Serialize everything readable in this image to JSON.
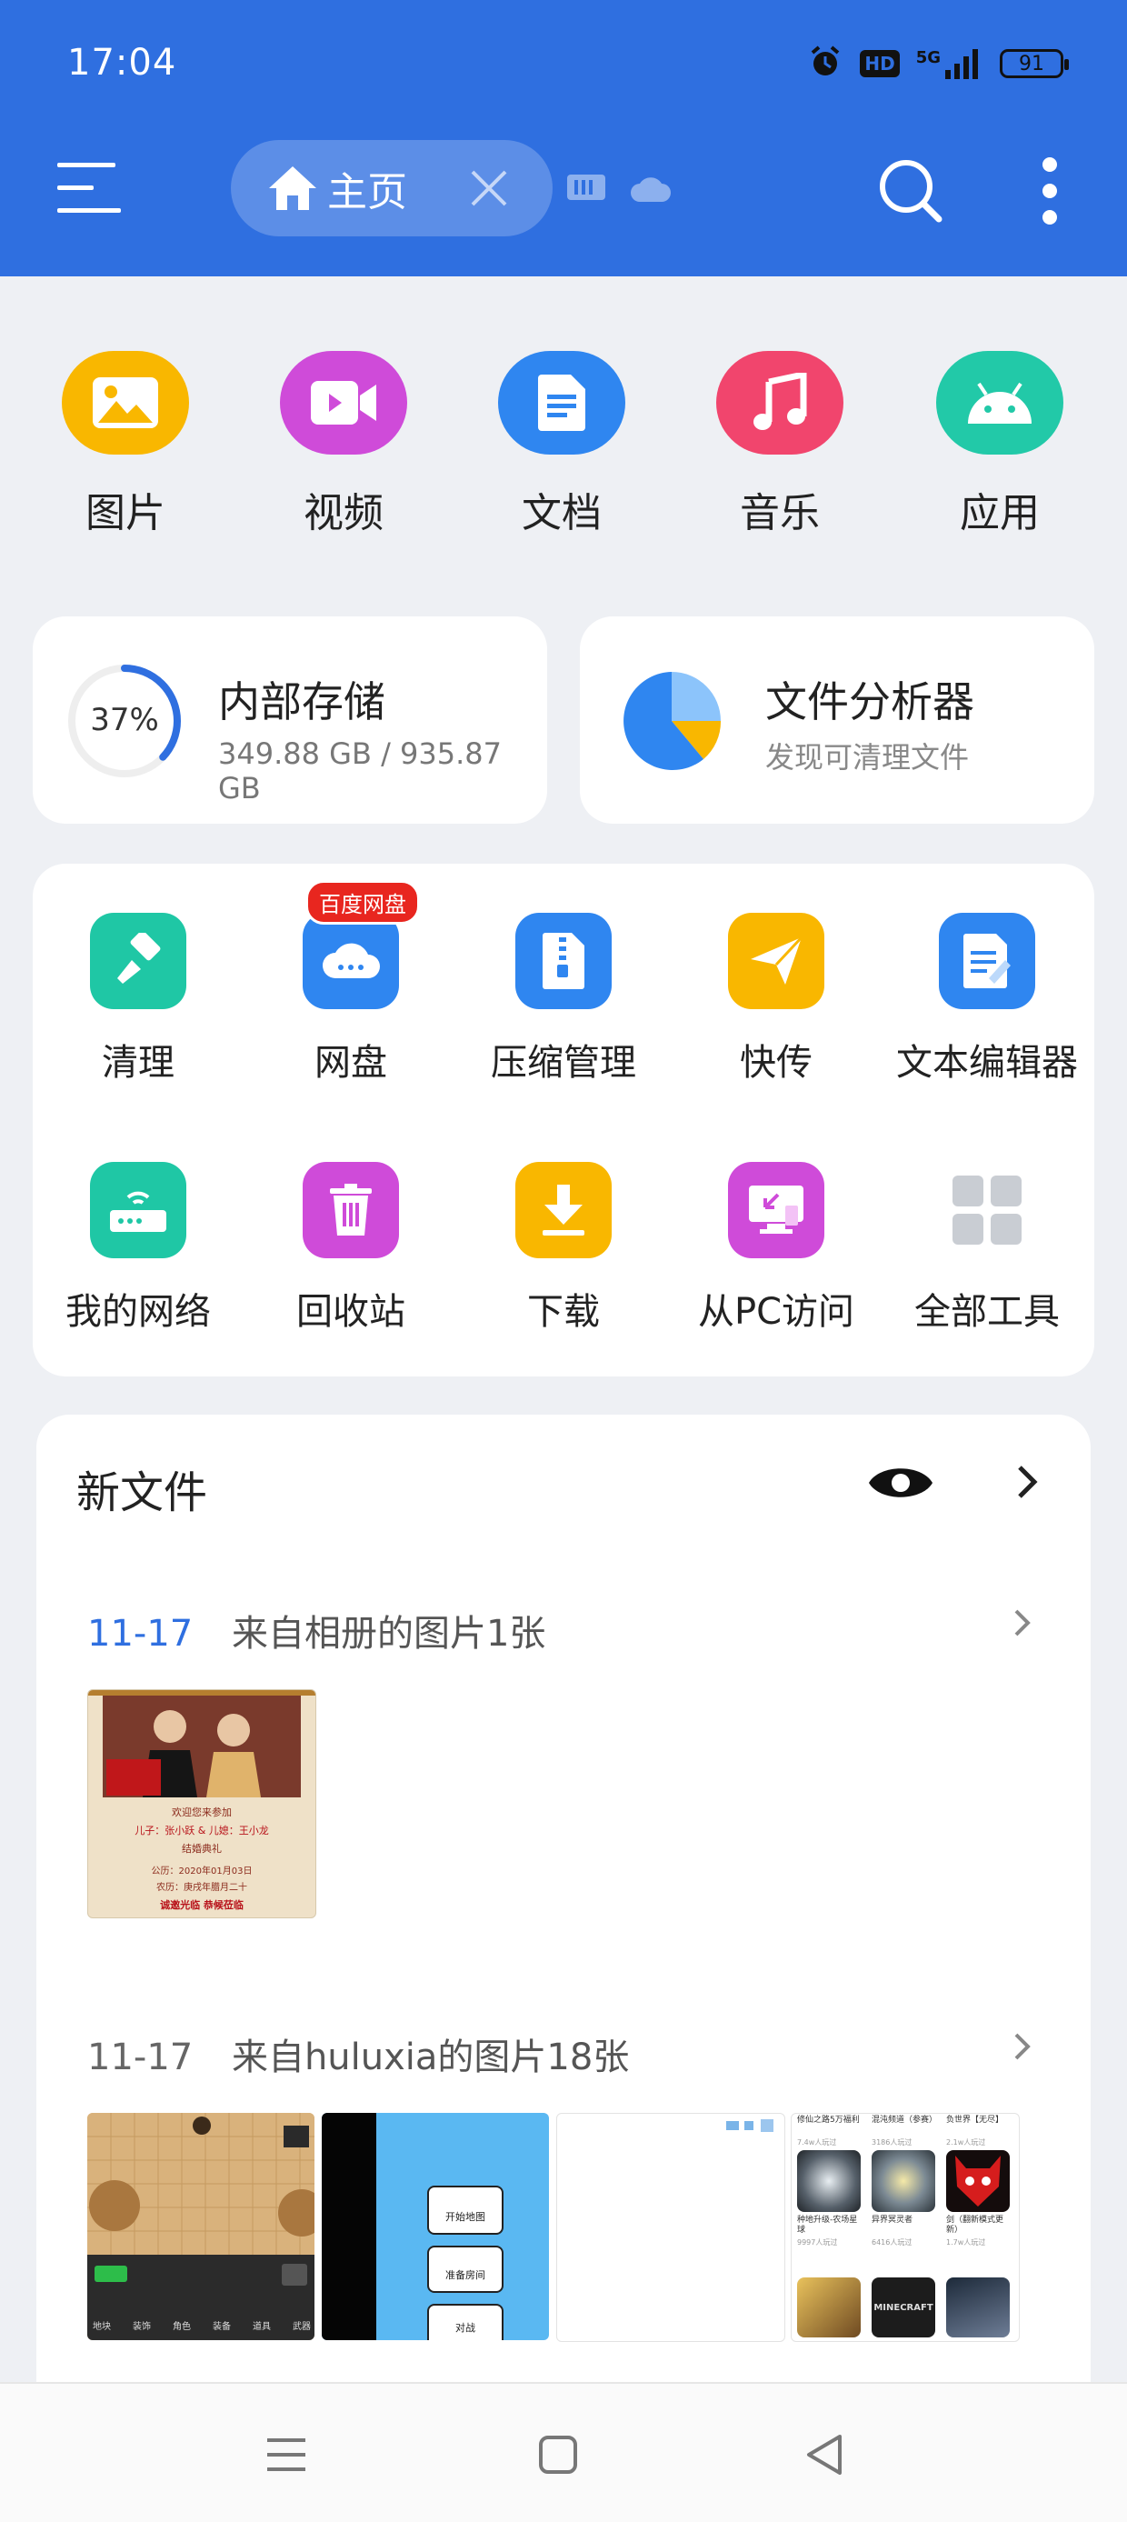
{
  "status": {
    "time": "17:04",
    "network": "5G",
    "hd": "HD",
    "battery": "91"
  },
  "header": {
    "tab_label": "主页"
  },
  "categories": [
    {
      "label": "图片",
      "icon": "image-icon",
      "color": "#f9b700"
    },
    {
      "label": "视频",
      "icon": "video-icon",
      "color": "#cf4bd9"
    },
    {
      "label": "文档",
      "icon": "document-icon",
      "color": "#2f86f0"
    },
    {
      "label": "音乐",
      "icon": "music-icon",
      "color": "#f1456d"
    },
    {
      "label": "应用",
      "icon": "android-icon",
      "color": "#22c9a8"
    }
  ],
  "storage": {
    "title": "内部存储",
    "percent_label": "37%",
    "percent": 37,
    "usage": "349.88 GB / 935.87 GB"
  },
  "analyzer": {
    "title": "文件分析器",
    "subtitle": "发现可清理文件"
  },
  "tools": [
    {
      "label": "清理",
      "icon": "brush-icon",
      "color": "#1fc7a5"
    },
    {
      "label": "网盘",
      "icon": "cloud-icon",
      "color": "#2f86f0",
      "badge": "百度网盘"
    },
    {
      "label": "压缩管理",
      "icon": "zip-icon",
      "color": "#2f86f0"
    },
    {
      "label": "快传",
      "icon": "paper-plane-icon",
      "color": "#f9b700"
    },
    {
      "label": "文本编辑器",
      "icon": "text-editor-icon",
      "color": "#2f86f0"
    },
    {
      "label": "我的网络",
      "icon": "router-icon",
      "color": "#1fc7a5"
    },
    {
      "label": "回收站",
      "icon": "trash-icon",
      "color": "#cf4bd9"
    },
    {
      "label": "下载",
      "icon": "download-icon",
      "color": "#f9b700"
    },
    {
      "label": "从PC访问",
      "icon": "pc-access-icon",
      "color": "#cf4bd9"
    },
    {
      "label": "全部工具",
      "icon": "grid-icon",
      "color": "#c9cdd3"
    }
  ],
  "new_files": {
    "title": "新文件",
    "groups": [
      {
        "date": "11-17",
        "desc": "来自相册的图片1张",
        "date_color": "#2f6fe0"
      },
      {
        "date": "11-17",
        "desc": "来自huluxia的图片18张",
        "date_color": "#666666"
      }
    ],
    "thumb1": {
      "line1": "欢迎您来参加",
      "line2": "儿子：张小跃  &  儿媳：王小龙",
      "line3": "结婚典礼",
      "line4": "公历：2020年01月03日",
      "line5": "农历：庚戌年腊月二十",
      "line6": "诚邀光临 恭候莅临"
    },
    "thumb3": {
      "btn1": "开始地图",
      "btn2": "准备房间",
      "btn3": "对战"
    },
    "thumb5": {
      "c1": "修仙之路5万福利",
      "c1s": "7.4w人玩过",
      "c2": "混沌频道（参赛）",
      "c2s": "3186人玩过",
      "c3": "负世界【无尽】",
      "c3s": "2.1w人玩过",
      "c4": "种地升级-农场星球",
      "c4s": "9997人玩过",
      "c5": "异界冥灵者",
      "c5s": "6416人玩过",
      "c6": "剑（翻新模式更新）",
      "c6s": "1.7w人玩过",
      "c8": "MINECRAFT"
    },
    "thumb2": {
      "tabs": [
        "地块",
        "装饰",
        "角色",
        "装备",
        "道具",
        "武器"
      ]
    }
  }
}
